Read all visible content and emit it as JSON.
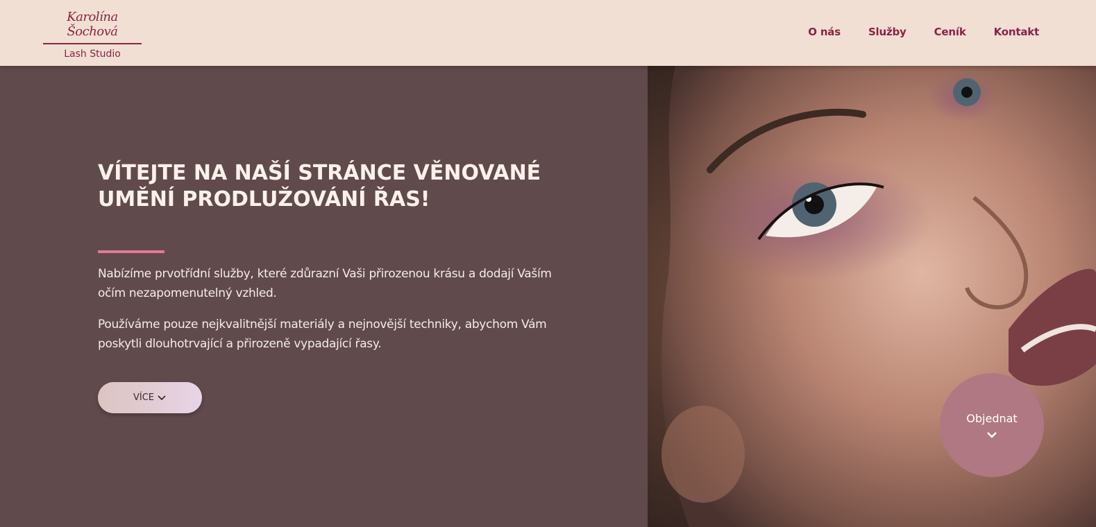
{
  "header": {
    "logo_name": "Karolína Šochová",
    "logo_sub": "Lash Studio",
    "nav": [
      {
        "label": "O nás"
      },
      {
        "label": "Služby"
      },
      {
        "label": "Ceník"
      },
      {
        "label": "Kontakt"
      }
    ]
  },
  "hero": {
    "title": "VÍTEJTE NA NAŠÍ STRÁNCE VĚNOVANÉ UMĚNÍ PRODLUŽOVÁNÍ ŘAS!",
    "paragraph1": "Nabízíme prvotřídní služby, které zdůrazní Vaši přirozenou krásu a dodají Vaším očím nezapomenutelný vzhled.",
    "paragraph2": "Používáme pouze nejkvalitnější materiály a nejnovější techniky, abychom Vám poskytli dlouhotrvající a přirozeně vypadající řasy.",
    "more_button": "VÍCE",
    "image_icon": "portrait-photo"
  },
  "order_button": {
    "label": "Objednat",
    "icon": "chevron-down-icon"
  },
  "colors": {
    "header_bg": "#f0dfd2",
    "brand": "#8c2246",
    "hero_bg": "#614a4c",
    "accent_underline": "#e27a9a",
    "order_bg": "#b07882"
  }
}
